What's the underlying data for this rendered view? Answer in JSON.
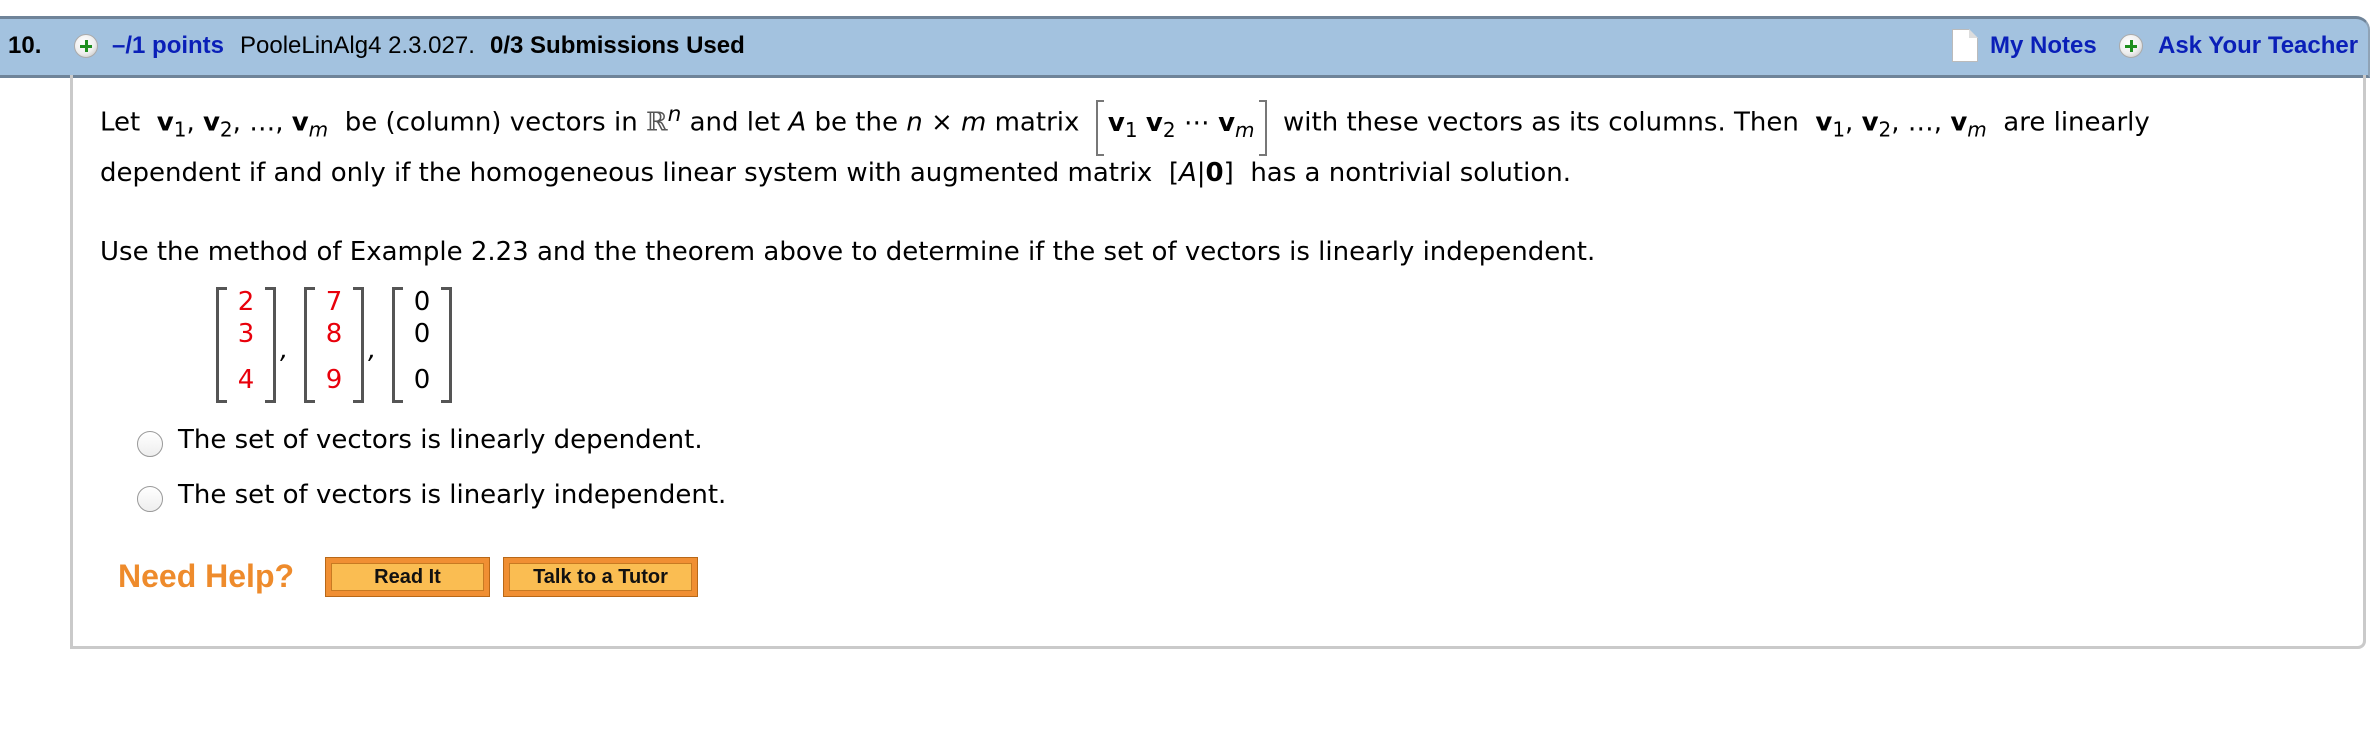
{
  "header": {
    "question_number": "10.",
    "points": "–/1 points",
    "reference": "PooleLinAlg4 2.3.027.",
    "submissions": "0/3 Submissions Used",
    "my_notes": "My Notes",
    "ask_teacher": "Ask Your Teacher",
    "icons": [
      "plus-circle-icon",
      "note-page-icon",
      "plus-circle-icon"
    ]
  },
  "theorem": {
    "let": "Let",
    "v1": "v",
    "s1": "1",
    "v2": "v",
    "s2": "2",
    "dots": "…",
    "vm": "v",
    "sm": "m",
    "t1": "be (column) vectors in",
    "R": "ℝ",
    "n": "n",
    "t2": "and let",
    "A": "A",
    "t3": "be the",
    "nxm_n": "n",
    "times": "×",
    "nxm_m": "m",
    "t4": "matrix",
    "cdots": "⋯",
    "t5": "with these vectors as its columns. Then",
    "t6": "are linearly",
    "line2a": "dependent if and only if the homogeneous linear system with augmented matrix",
    "aug_open": "[",
    "aug_A": "A",
    "aug_bar": "|",
    "aug_zero": "0",
    "aug_close": "]",
    "line2b": "has a nontrivial solution."
  },
  "instruction": "Use the method of Example 2.23 and the theorem above to determine if the set of vectors is linearly independent.",
  "vectors": [
    {
      "entries": [
        "2",
        "3",
        "4"
      ],
      "color": "#E8000B"
    },
    {
      "entries": [
        "7",
        "8",
        "9"
      ],
      "color": "#E8000B"
    },
    {
      "entries": [
        "0",
        "0",
        "0"
      ],
      "color": "#000000"
    }
  ],
  "vector_separator": ",",
  "options": [
    {
      "label": "The set of vectors is linearly dependent.",
      "selected": false
    },
    {
      "label": "The set of vectors is linearly independent.",
      "selected": false
    }
  ],
  "help": {
    "label": "Need Help?",
    "read_it": "Read It",
    "tutor": "Talk to a Tutor"
  },
  "colors": {
    "header_bg": "#A3C2DF",
    "link": "#0A1FB8",
    "help": "#EE8B2C",
    "vector_entry": "#E8000B"
  }
}
